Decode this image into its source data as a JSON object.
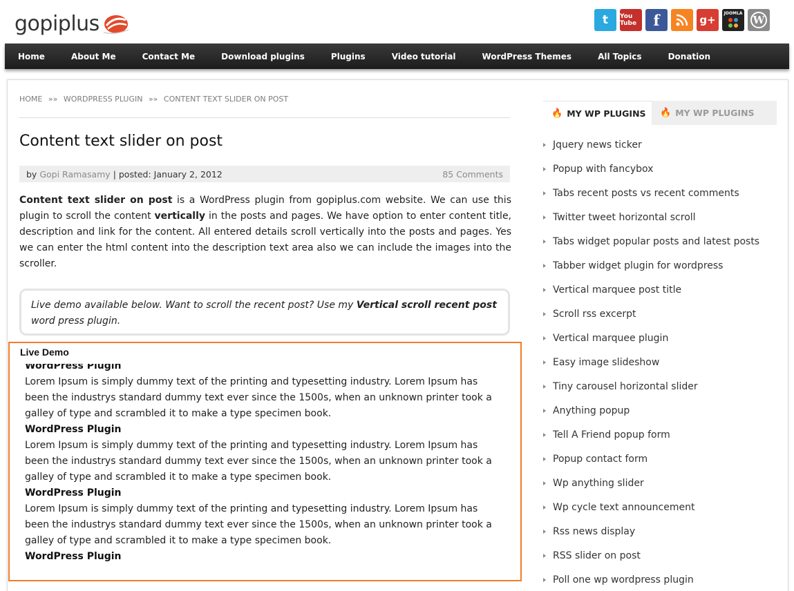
{
  "header": {
    "logo_text": "gopiplus",
    "social_icons": [
      {
        "name": "twitter-icon",
        "glyph": "t"
      },
      {
        "name": "youtube-icon",
        "glyph": "You Tube"
      },
      {
        "name": "facebook-icon",
        "glyph": "f"
      },
      {
        "name": "rss-icon",
        "glyph": "◠"
      },
      {
        "name": "google-plus-icon",
        "glyph": "g+"
      },
      {
        "name": "joomla-icon",
        "glyph": "JOOMLA"
      },
      {
        "name": "wordpress-icon",
        "glyph": "W"
      }
    ]
  },
  "nav": {
    "items": [
      "Home",
      "About Me",
      "Contact Me",
      "Download plugins",
      "Plugins",
      "Video tutorial",
      "WordPress Themes",
      "All Topics",
      "Donation"
    ]
  },
  "breadcrumb": {
    "items": [
      "HOME",
      "WORDPRESS PLUGIN",
      "CONTENT TEXT SLIDER ON POST"
    ],
    "separator": "»»"
  },
  "post": {
    "title": "Content text slider on post",
    "meta": {
      "by": "by",
      "author": "Gopi Ramasamy",
      "posted": "| posted: January 2, 2012",
      "comments": "85 Comments"
    },
    "intro": {
      "bold_lead": "Content text slider on post",
      "part1": " is a WordPress plugin from gopiplus.com website. We can use this plugin to scroll the content ",
      "bold_mid": "vertically",
      "part2": " in the posts and pages. We have option to enter content title, description and link for the content. All entered details scroll vertically into the posts and pages. Yes we can enter the html content into the description text area also we can include the images into the scroller."
    },
    "quote": {
      "part1": "Live demo available below. Want to scroll the recent post? Use my ",
      "bold": "Vertical scroll recent post",
      "part2": " word press plugin."
    }
  },
  "demo": {
    "label": "Live Demo",
    "items": [
      {
        "title": "WordPress Plugin",
        "desc": "Lorem Ipsum is simply dummy text of the printing and typesetting industry. Lorem Ipsum has been the industrys standard dummy text ever since the 1500s, when an unknown printer took a galley of type and scrambled it to make a type specimen book."
      },
      {
        "title": "WordPress Plugin",
        "desc": "Lorem Ipsum is simply dummy text of the printing and typesetting industry. Lorem Ipsum has been the industrys standard dummy text ever since the 1500s, when an unknown printer took a galley of type and scrambled it to make a type specimen book."
      },
      {
        "title": "WordPress Plugin",
        "desc": "Lorem Ipsum is simply dummy text of the printing and typesetting industry. Lorem Ipsum has been the industrys standard dummy text ever since the 1500s, when an unknown printer took a galley of type and scrambled it to make a type specimen book."
      },
      {
        "title": "WordPress Plugin",
        "desc": ""
      }
    ]
  },
  "sidebar": {
    "tabs": [
      "MY WP PLUGINS",
      "MY WP PLUGINS"
    ],
    "plugins": [
      "Jquery news ticker",
      "Popup with fancybox",
      "Tabs recent posts vs recent comments",
      "Twitter tweet horizontal scroll",
      "Tabs widget popular posts and latest posts",
      "Tabber widget plugin for wordpress",
      "Vertical marquee post title",
      "Scroll rss excerpt",
      "Vertical marquee plugin",
      "Easy image slideshow",
      "Tiny carousel horizontal slider",
      "Anything popup",
      "Tell A Friend popup form",
      "Popup contact form",
      "Wp anything slider",
      "Wp cycle text announcement",
      "Rss news display",
      "RSS slider on post",
      "Poll one wp wordpress plugin"
    ]
  },
  "colors": {
    "nav_bg": "#2a2a2a",
    "demo_border": "#f07d2a",
    "logo_accent": "#e24a2b"
  }
}
